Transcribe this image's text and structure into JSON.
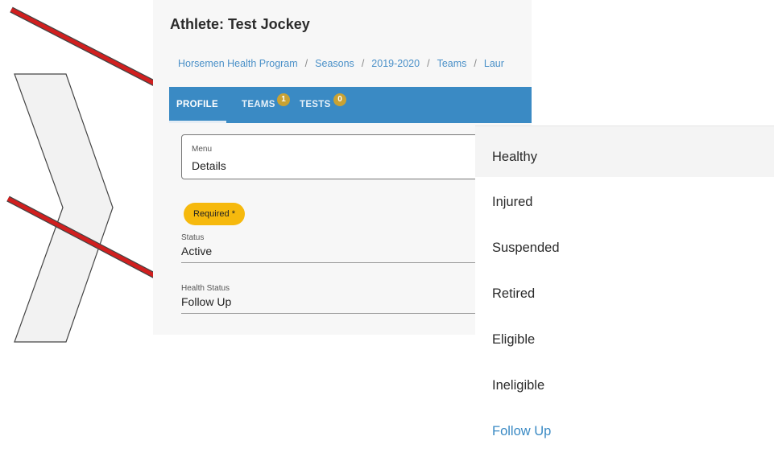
{
  "header": {
    "title": "Athlete: Test Jockey"
  },
  "breadcrumb": [
    "Horsemen Health Program",
    "Seasons",
    "2019-2020",
    "Teams",
    "Laur"
  ],
  "breadcrumb_separator": "/",
  "tabs": [
    {
      "label": "PROFILE",
      "active": true
    },
    {
      "label": "TEAMS",
      "badge": "1"
    },
    {
      "label": "TESTS",
      "badge": "0"
    }
  ],
  "menu": {
    "label": "Menu",
    "value": "Details"
  },
  "required_badge": "Required *",
  "status_field": {
    "label": "Status",
    "value": "Active"
  },
  "health_field": {
    "label": "Health Status",
    "value": "Follow Up"
  },
  "dropdown": {
    "options": [
      "Healthy",
      "Injured",
      "Suspended",
      "Retired",
      "Eligible",
      "Ineligible",
      "Follow Up"
    ],
    "highlighted": "Healthy",
    "selected": "Follow Up"
  },
  "colors": {
    "tabbar": "#3a8ac4",
    "badge": "#c9a233",
    "required": "#f6b90d",
    "link": "#4a90c8",
    "arrow": "#d11f1f"
  }
}
